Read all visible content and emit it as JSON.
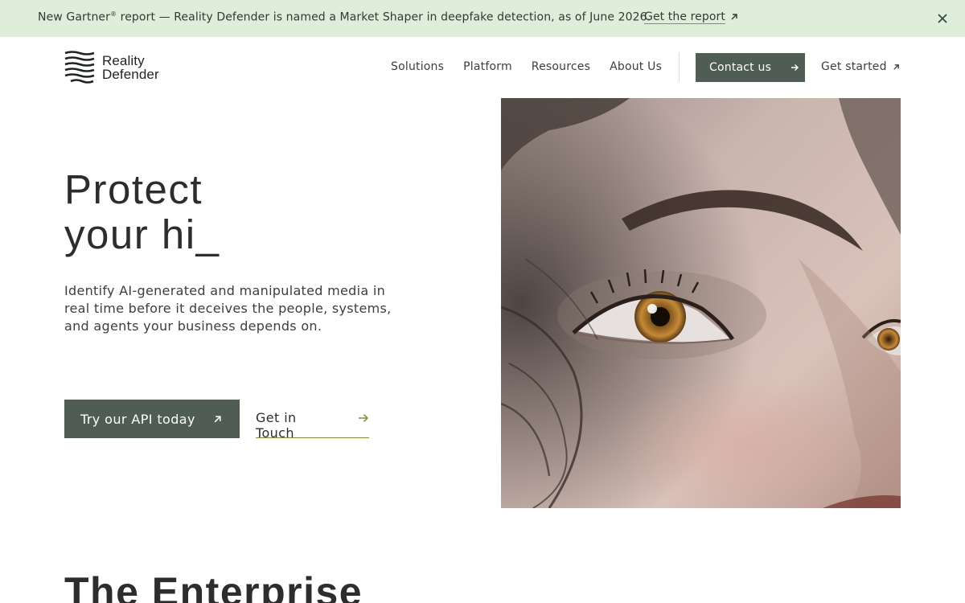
{
  "announcement": {
    "message_prefix": "New Gartner",
    "message_mark": "®",
    "message_suffix": " report — Reality Defender is named a Market Shaper in deepfake detection, as of June 2026.",
    "link_label": "Get the report",
    "link_icon": "arrow-up-right-icon",
    "close_icon": "close-icon",
    "background_color": "#dfeedb"
  },
  "brand": {
    "name_line1": "Reality",
    "name_line2": "Defender",
    "logo_icon": "reality-defender-logo"
  },
  "nav": {
    "items": [
      {
        "label": "Solutions"
      },
      {
        "label": "Platform"
      },
      {
        "label": "Resources"
      },
      {
        "label": "About Us"
      }
    ],
    "contact_label": "Contact us",
    "contact_icon": "arrow-right-icon",
    "get_started_label": "Get started",
    "get_started_icon": "arrow-up-right-icon"
  },
  "hero": {
    "title_line1": "Protect",
    "title_line2": "your hi_",
    "subtitle": "Identify AI-generated and manipulated media in real time before it deceives the people, systems, and agents your business depends on.",
    "primary_cta": "Try our API today",
    "primary_icon": "arrow-up-right-icon",
    "secondary_cta": "Get in Touch",
    "secondary_icon": "arrow-right-icon",
    "image": "close-up-face-eye-photo"
  },
  "section": {
    "title": "The Enterprise"
  },
  "colors": {
    "accent_button": "#4f5d54",
    "link_underline": "#7a8f3a",
    "text": "#2b2e2c"
  }
}
